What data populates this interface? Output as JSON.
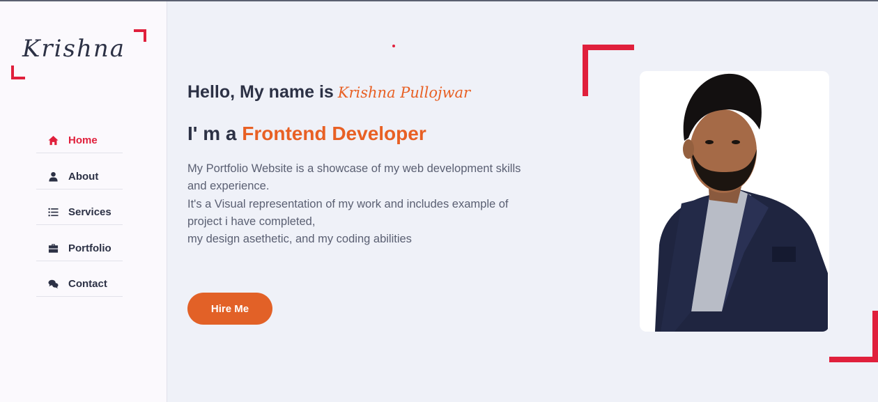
{
  "brand": {
    "logo_text": "Krishna"
  },
  "sidebar": {
    "items": [
      {
        "label": "Home",
        "icon": "home-icon",
        "active": true
      },
      {
        "label": "About",
        "icon": "user-icon",
        "active": false
      },
      {
        "label": "Services",
        "icon": "list-icon",
        "active": false
      },
      {
        "label": "Portfolio",
        "icon": "briefcase-icon",
        "active": false
      },
      {
        "label": "Contact",
        "icon": "chat-icon",
        "active": false
      }
    ]
  },
  "hero": {
    "greeting_prefix": "Hello, My name is",
    "name": "Krishna Pullojwar",
    "role_prefix": "I' m a",
    "role_highlight": "Frontend Developer",
    "description_lines": [
      "My Portfolio Website is a showcase of my web development skills",
      "and experience.",
      "It's a Visual representation of my work and includes example of",
      "project i have completed,",
      "my design asethetic, and my coding abilities"
    ],
    "cta_label": "Hire Me"
  },
  "colors": {
    "accent_red": "#e0203c",
    "accent_orange": "#e26127",
    "text_dark": "#2c3145",
    "background": "#eff1f8"
  }
}
